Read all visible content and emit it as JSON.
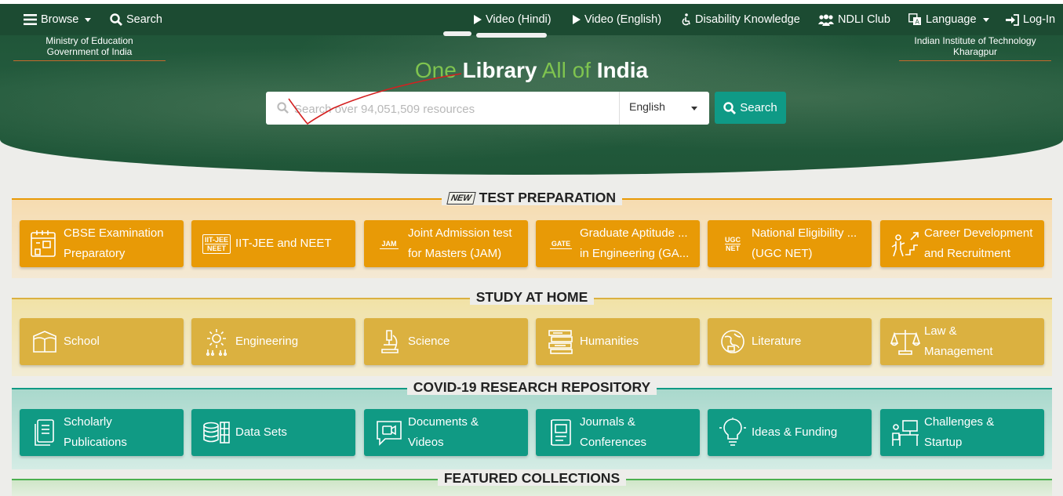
{
  "navbar": {
    "browse": "Browse",
    "search": "Search",
    "video_hindi": "Video (Hindi)",
    "video_english": "Video (English)",
    "disability": "Disability Knowledge",
    "club": "NDLI Club",
    "language": "Language",
    "login": "Log-In"
  },
  "header": {
    "ministry_line1": "Ministry of Education",
    "ministry_line2": "Government of India",
    "iit_line1": "Indian Institute of Technology",
    "iit_line2": "Kharagpur",
    "tagline": {
      "w1": "One",
      "w2": "Library",
      "w3": "All of",
      "w4": "India"
    }
  },
  "search": {
    "placeholder": "Search over 94,051,509 resources",
    "language": "English",
    "button": "Search"
  },
  "sections": {
    "test_prep": {
      "badge": "NEW",
      "title": "TEST PREPARATION",
      "items": [
        {
          "label": "CBSE Examination Preparatory",
          "icon": "calendar-exam-icon"
        },
        {
          "label": "IIT-JEE and NEET",
          "icon": "iit-jee-neet-icon",
          "icon_text1": "IIT-JEE",
          "icon_text2": "NEET"
        },
        {
          "label": "Joint Admission test for Masters (JAM)",
          "icon": "jam-icon",
          "icon_text1": "JAM"
        },
        {
          "label": "Graduate Aptitude ... in Engineering (GA...",
          "icon": "gate-icon",
          "icon_text1": "GATE"
        },
        {
          "label": "National Eligibility ... (UGC NET)",
          "icon": "ugc-net-icon",
          "icon_text1": "UGC",
          "icon_text2": "NET"
        },
        {
          "label": "Career Development and Recruitment",
          "icon": "career-ladder-icon"
        }
      ]
    },
    "study_home": {
      "title": "STUDY AT HOME",
      "items": [
        {
          "label": "School",
          "icon": "school-icon"
        },
        {
          "label": "Engineering",
          "icon": "engineering-gear-icon"
        },
        {
          "label": "Science",
          "icon": "microscope-icon"
        },
        {
          "label": "Humanities",
          "icon": "books-icon"
        },
        {
          "label": "Literature",
          "icon": "globe-book-icon"
        },
        {
          "label": "Law & Management",
          "icon": "scales-icon"
        }
      ]
    },
    "covid": {
      "title": "COVID-19 RESEARCH REPOSITORY",
      "items": [
        {
          "label": "Scholarly Publications",
          "icon": "publication-icon"
        },
        {
          "label": "Data Sets",
          "icon": "database-icon"
        },
        {
          "label": "Documents & Videos",
          "icon": "video-chat-icon"
        },
        {
          "label": "Journals & Conferences",
          "icon": "journal-icon"
        },
        {
          "label": "Ideas & Funding",
          "icon": "lightbulb-icon"
        },
        {
          "label": "Challenges & Startup",
          "icon": "startup-desk-icon"
        }
      ]
    },
    "featured": {
      "title": "FEATURED COLLECTIONS"
    }
  },
  "colors": {
    "nav_bg": "#1c4b32",
    "orange": "#e89a06",
    "gold": "#dbb140",
    "teal": "#109a84",
    "accent_green": "#7fc44f"
  }
}
